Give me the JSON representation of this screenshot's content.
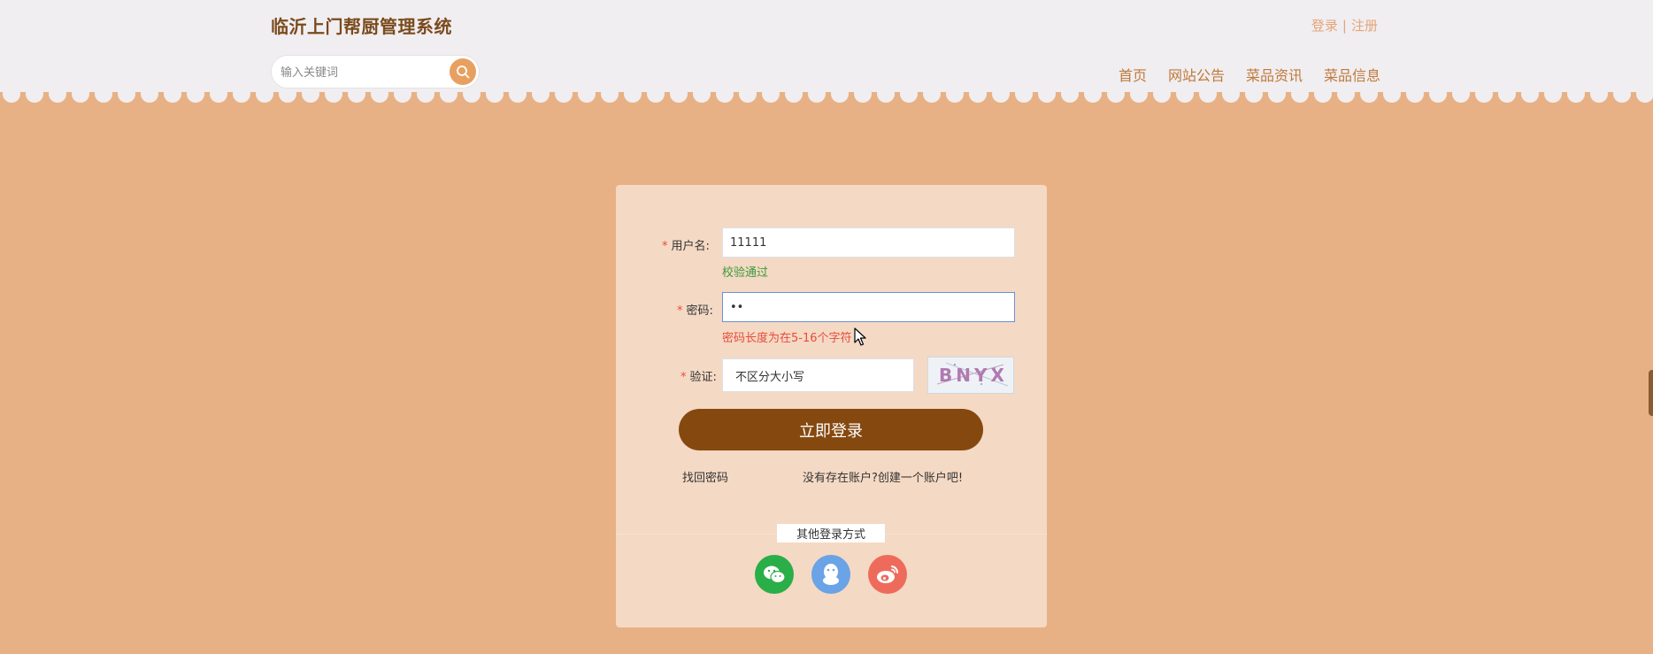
{
  "header": {
    "site_title": "临沂上门帮厨管理系统",
    "login_link": "登录",
    "separator": "|",
    "register_link": "注册",
    "search": {
      "placeholder": "输入关键词"
    },
    "nav": [
      "首页",
      "网站公告",
      "菜品资讯",
      "菜品信息"
    ]
  },
  "form": {
    "username": {
      "label": "用户名:",
      "value": "11111",
      "message": "校验通过"
    },
    "password": {
      "label": "密码:",
      "value": "••",
      "message": "密码长度为在5-16个字符"
    },
    "captcha": {
      "label": "验证:",
      "placeholder": "不区分大小写",
      "image_text": "BNYX"
    },
    "required_mark": "*",
    "login_button": "立即登录",
    "forgot_link": "找回密码",
    "register_prompt": "没有存在账户?创建一个账户吧!",
    "other_login_label": "其他登录方式",
    "social_icons": [
      "wechat-icon",
      "qq-icon",
      "weibo-icon"
    ]
  },
  "colors": {
    "brand_dark": "#85490f",
    "page_orange": "#e8b185",
    "card_bg": "#f4d9c4",
    "accent": "#e8a060",
    "success": "#3b9a3b",
    "error": "#e84c3d",
    "wechat": "#2aae48",
    "qq": "#6aa3e6",
    "weibo": "#ee6b5c"
  }
}
